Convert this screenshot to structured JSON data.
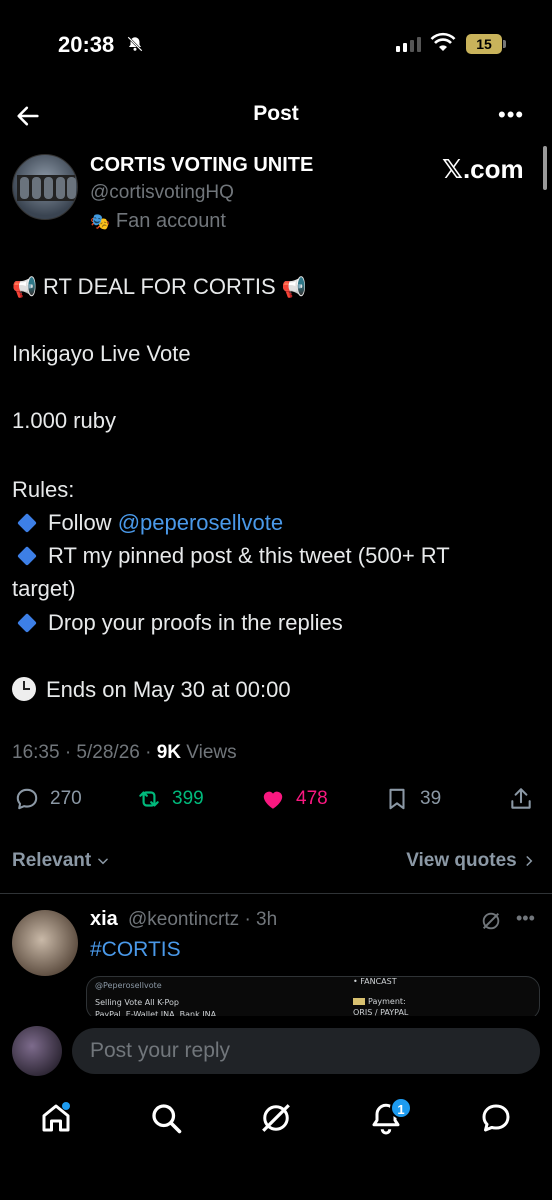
{
  "status_bar": {
    "time": "20:38",
    "battery": "15"
  },
  "header": {
    "title": "Post"
  },
  "author": {
    "name": "CORTIS VOTING UNITE",
    "handle": "@cortisvotingHQ",
    "label": "Fan account",
    "badge": "𝕏.com"
  },
  "tweet": {
    "headline": "RT DEAL FOR CORTIS",
    "line1": "Inkigayo Live Vote",
    "line2": "1.000 ruby",
    "rules_title": "Rules:",
    "rule1_prefix": "Follow ",
    "rule1_mention": "@peperosellvote",
    "rule2_a": "RT my pinned post & this tweet (500+ RT",
    "rule2_b": "target)",
    "rule3": "Drop your proofs in the replies",
    "ends": "Ends on May 30 at 00:00"
  },
  "meta": {
    "timestamp": "16:35 · 5/28/26 · ",
    "views_count": "9K",
    "views_label": " Views"
  },
  "actions": {
    "replies": "270",
    "reposts": "399",
    "likes": "478",
    "bookmarks": "39"
  },
  "sort": {
    "relevant": "Relevant",
    "view_quotes": "View quotes"
  },
  "reply": {
    "name": "xia",
    "meta": "@keontincrtz · 3h",
    "hashtag": "#CORTIS",
    "card": {
      "handle": "@Peperosellvote",
      "line1": "Selling Vote All K-Pop",
      "line2": "PayPal, E-Wallet INA, Bank INA",
      "fancast": "• FANCAST",
      "payment": "Payment:",
      "payment_methods": "ORIS / PAYPAL"
    }
  },
  "composer": {
    "placeholder": "Post your reply"
  },
  "nav": {
    "notifications_badge": "1"
  },
  "colors": {
    "accent": "#1d9bf0",
    "like": "#f91880",
    "repost": "#00ba7c",
    "muted": "#71767b"
  }
}
